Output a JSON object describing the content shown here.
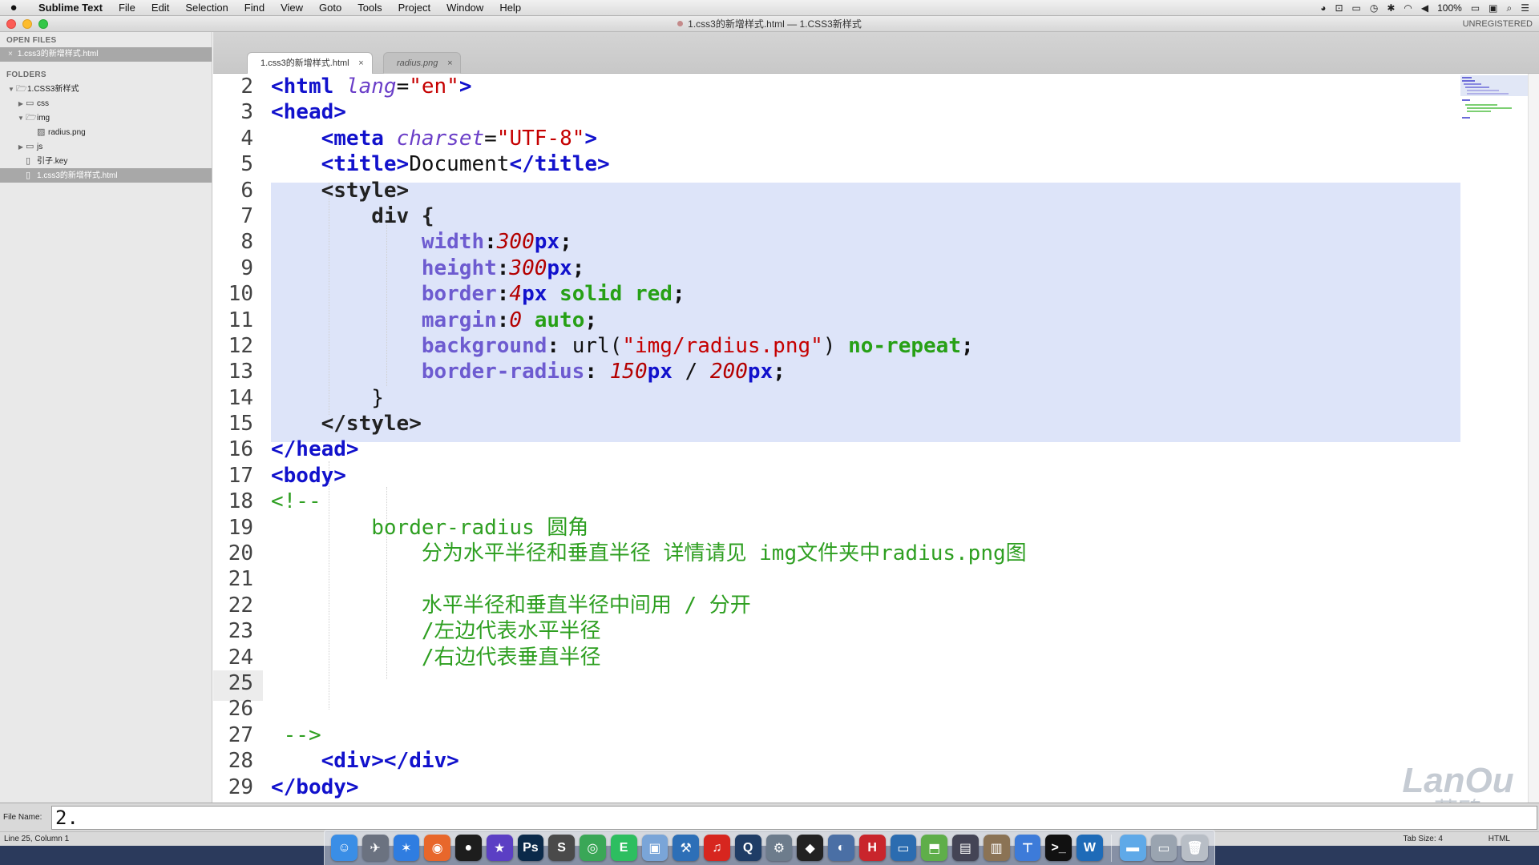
{
  "menubar": {
    "app": "Sublime Text",
    "items": [
      "File",
      "Edit",
      "Selection",
      "Find",
      "View",
      "Goto",
      "Tools",
      "Project",
      "Window",
      "Help"
    ],
    "battery": "100%"
  },
  "window": {
    "title": "1.css3的新增样式.html — 1.CSS3新样式",
    "unregistered": "UNREGISTERED"
  },
  "sidebar": {
    "open_files_label": "OPEN FILES",
    "open_file": "1.css3的新增样式.html",
    "folders_label": "FOLDERS",
    "tree": {
      "root": "1.CSS3新样式",
      "css": "css",
      "img": "img",
      "radius": "radius.png",
      "js": "js",
      "key": "引子.key",
      "html": "1.css3的新增样式.html"
    }
  },
  "tabs": {
    "active": "1.css3的新增样式.html",
    "inactive": "radius.png",
    "close": "×"
  },
  "editor": {
    "line_numbers": [
      "2",
      "3",
      "4",
      "5",
      "6",
      "7",
      "8",
      "9",
      "10",
      "11",
      "12",
      "13",
      "14",
      "15",
      "16",
      "17",
      "18",
      "19",
      "20",
      "21",
      "22",
      "23",
      "24",
      "25",
      "26",
      "27",
      "28",
      "29"
    ],
    "comment_lines": {
      "l19": "border-radius 圆角",
      "l20": "分为水平半径和垂直半径 详情请见 img文件夹中radius.png图",
      "l22": "水平半径和垂直半径中间用 / 分开",
      "l23": "/左边代表水平半径",
      "l24": "/右边代表垂直半径"
    }
  },
  "watermark": {
    "en": "LanOu",
    "cn": "蓝鸥"
  },
  "bottom": {
    "filename_label": "File Name:",
    "filename_value": "2.",
    "status_position": "Line 25, Column 1",
    "tab_size": "Tab Size: 4",
    "syntax": "HTML"
  },
  "dock": {
    "apps": [
      {
        "icon": "finder-icon",
        "glyph": "☺",
        "color": "#3a8ee6"
      },
      {
        "icon": "launchpad-icon",
        "glyph": "✈",
        "color": "#6b7280"
      },
      {
        "icon": "safari-icon",
        "glyph": "✶",
        "color": "#2f7de1"
      },
      {
        "icon": "firefox-icon",
        "glyph": "◉",
        "color": "#e8672b"
      },
      {
        "icon": "qq-icon",
        "glyph": "●",
        "color": "#1d1d1d"
      },
      {
        "icon": "imovie-star-icon",
        "glyph": "★",
        "color": "#5b3fc4"
      },
      {
        "icon": "photoshop-icon",
        "glyph": "Ps",
        "color": "#0b2a4a"
      },
      {
        "icon": "sublime-text-icon",
        "glyph": "S",
        "color": "#4a4a4a"
      },
      {
        "icon": "chrome-icon",
        "glyph": "◎",
        "color": "#3aa757"
      },
      {
        "icon": "evernote-icon",
        "glyph": "E",
        "color": "#2dbe60"
      },
      {
        "icon": "preview-icon",
        "glyph": "▣",
        "color": "#7aa5d8"
      },
      {
        "icon": "xcode-icon",
        "glyph": "⚒",
        "color": "#2d6fb7"
      },
      {
        "icon": "netease-music-icon",
        "glyph": "♫",
        "color": "#d7261f"
      },
      {
        "icon": "quicktime-icon",
        "glyph": "Q",
        "color": "#1f3d66"
      },
      {
        "icon": "system-prefs-icon",
        "glyph": "⚙",
        "color": "#6d7c8c"
      },
      {
        "icon": "unity-icon",
        "glyph": "◆",
        "color": "#222"
      },
      {
        "icon": "qq-browser-icon",
        "glyph": "◐",
        "color": "#4a6fa5"
      },
      {
        "icon": "hbuilder-icon",
        "glyph": "H",
        "color": "#c9252c"
      },
      {
        "icon": "screen-icon",
        "glyph": "▭",
        "color": "#2b6cb0"
      },
      {
        "icon": "maps-icon",
        "glyph": "⬒",
        "color": "#5fae4a"
      },
      {
        "icon": "movie-maker-icon",
        "glyph": "▤",
        "color": "#445"
      },
      {
        "icon": "notes-icon",
        "glyph": "▥",
        "color": "#8b7355"
      },
      {
        "icon": "keynote-icon",
        "glyph": "⊤",
        "color": "#3d7bd9"
      },
      {
        "icon": "terminal-icon",
        "glyph": ">_",
        "color": "#111"
      },
      {
        "icon": "word-icon",
        "glyph": "W",
        "color": "#1e6bb8"
      },
      {
        "icon": "folder-icon",
        "glyph": "▬",
        "color": "#5fa9e8"
      },
      {
        "icon": "downloads-icon",
        "glyph": "▭",
        "color": "#9aa4b0"
      },
      {
        "icon": "trash-icon",
        "glyph": "🗑",
        "color": "#b8bec6"
      }
    ]
  }
}
